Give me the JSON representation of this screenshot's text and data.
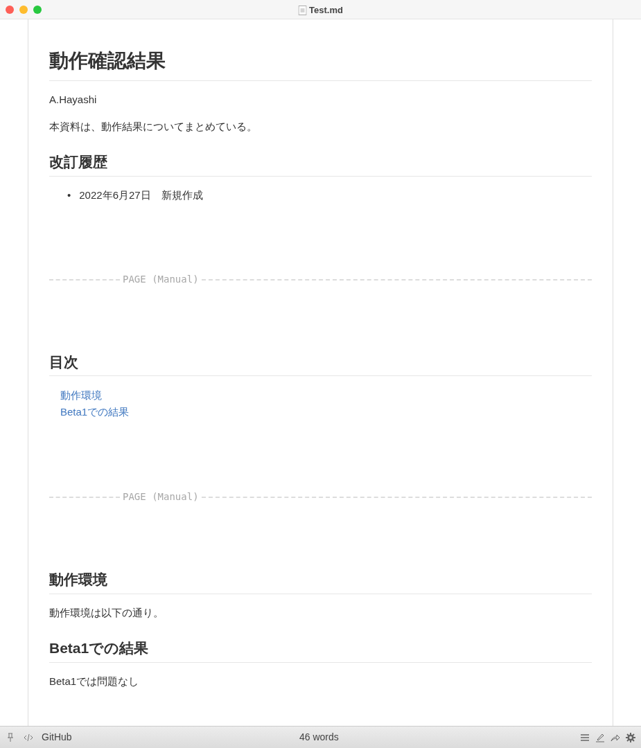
{
  "window": {
    "title": "Test.md"
  },
  "document": [
    {
      "kind": "h1",
      "text": "動作確認結果"
    },
    {
      "kind": "p",
      "text": "A.Hayashi"
    },
    {
      "kind": "p",
      "text": "本資料は、動作結果についてまとめている。"
    },
    {
      "kind": "h2",
      "text": "改訂履歴"
    },
    {
      "kind": "ul",
      "marker": "•",
      "items": [
        "2022年6月27日　新規作成"
      ]
    },
    {
      "kind": "pagebreak",
      "text": "PAGE (Manual)"
    },
    {
      "kind": "h2",
      "text": "目次"
    },
    {
      "kind": "toc",
      "items": [
        "動作環境",
        "Beta1での結果"
      ]
    },
    {
      "kind": "pagebreak",
      "text": "PAGE (Manual)"
    },
    {
      "kind": "h2",
      "text": "動作環境"
    },
    {
      "kind": "p",
      "text": "動作環境は以下の通り。"
    },
    {
      "kind": "h2",
      "text": "Beta1での結果"
    },
    {
      "kind": "p",
      "text": "Beta1では問題なし"
    }
  ],
  "status_bar": {
    "left_label": "GitHub",
    "word_count": "46 words"
  }
}
